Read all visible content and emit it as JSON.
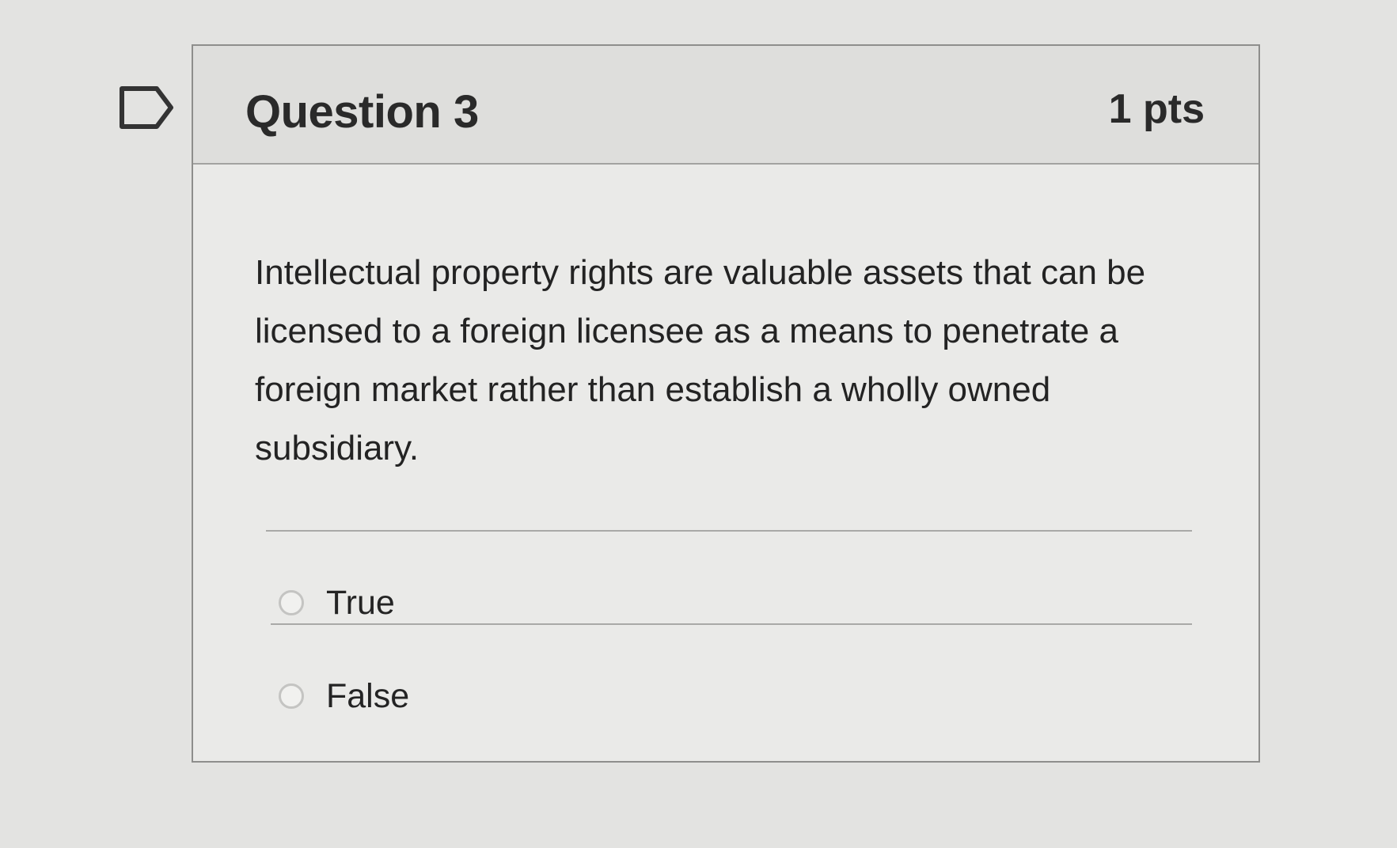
{
  "bookmark": {
    "icon": "bookmark-icon"
  },
  "question": {
    "title": "Question 3",
    "points": "1 pts",
    "text": "Intellectual property rights are valuable assets that can be licensed to a foreign licensee as a means to penetrate a foreign market rather than establish a wholly owned subsidiary.",
    "answers": [
      {
        "label": "True",
        "selected": false
      },
      {
        "label": "False",
        "selected": false
      }
    ]
  },
  "colors": {
    "background": "#e3e3e1",
    "card_background": "#eaeae8",
    "header_background": "#dededc",
    "border": "#8e8e8c",
    "text": "#2a2a2a",
    "radio_border": "#c4c4c2"
  }
}
